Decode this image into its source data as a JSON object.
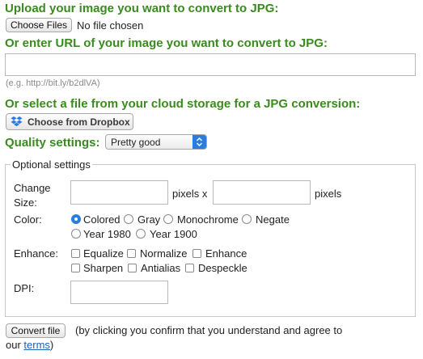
{
  "upload": {
    "heading": "Upload your image you want to convert to JPG:",
    "choose_files_label": "Choose Files",
    "file_status": "No file chosen"
  },
  "url": {
    "heading": "Or enter URL of your image you want to convert to JPG:",
    "value": "",
    "example": "(e.g. http://bit.ly/b2dlVA)"
  },
  "cloud": {
    "heading": "Or select a file from your cloud storage for a JPG conversion:",
    "dropbox_label": "Choose from Dropbox",
    "dropbox_icon": "dropbox-icon"
  },
  "quality": {
    "label": "Quality settings:",
    "selected": "Pretty good"
  },
  "optional": {
    "legend": "Optional settings",
    "change_size": {
      "label_line1": "Change",
      "label_line2": "Size:",
      "width_value": "",
      "pixels_x": "pixels x",
      "height_value": "",
      "pixels": "pixels"
    },
    "color": {
      "label": "Color:",
      "options": [
        "Colored",
        "Gray",
        "Monochrome",
        "Negate",
        "Year 1980",
        "Year 1900"
      ],
      "selected": "Colored"
    },
    "enhance": {
      "label": "Enhance:",
      "options": [
        "Equalize",
        "Normalize",
        "Enhance",
        "Sharpen",
        "Antialias",
        "Despeckle"
      ]
    },
    "dpi": {
      "label": "DPI:",
      "value": ""
    }
  },
  "convert": {
    "button_label": "Convert file",
    "notice_before": "(by clicking you confirm that you understand and agree to",
    "notice_our": "our",
    "terms_link": "terms",
    "notice_end": ")"
  },
  "colors": {
    "heading_green": "#3a8a1f",
    "select_accent": "#2a7ce0",
    "link_blue": "#1a5fb4"
  }
}
